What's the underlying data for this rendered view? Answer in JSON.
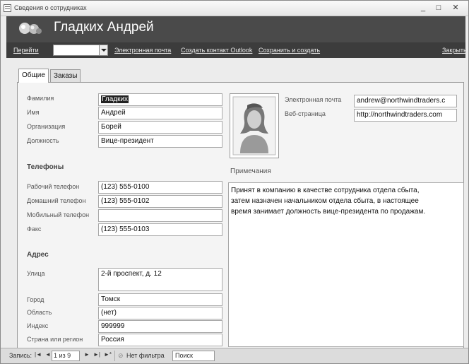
{
  "window": {
    "title": "Сведения о сотрудниках",
    "minimize": "_",
    "maximize": "□",
    "close": "✕"
  },
  "header": {
    "name": "Гладких Андрей"
  },
  "navbar": {
    "goto_label": "Перейти",
    "goto_value": "",
    "email_link": "Электронная почта",
    "outlook_link": "Создать контакт Outlook",
    "save_new_link": "Сохранить и создать",
    "close_link": "Закрыть"
  },
  "tabs": [
    {
      "label": "Общие"
    },
    {
      "label": "Заказы"
    }
  ],
  "general": {
    "last_name_label": "Фамилия",
    "last_name": "Гладких",
    "first_name_label": "Имя",
    "first_name": "Андрей",
    "company_label": "Организация",
    "company": "Борей",
    "job_title_label": "Должность",
    "job_title": "Вице-президент"
  },
  "phones": {
    "section": "Телефоны",
    "work_label": "Рабочий телефон",
    "work": "(123) 555-0100",
    "home_label": "Домашний телефон",
    "home": "(123) 555-0102",
    "mobile_label": "Мобильный телефон",
    "mobile": "",
    "fax_label": "Факс",
    "fax": "(123) 555-0103"
  },
  "address": {
    "section": "Адрес",
    "street_label": "Улица",
    "street": "2-й проспект, д. 12",
    "city_label": "Город",
    "city": "Томск",
    "region_label": "Область",
    "region": "(нет)",
    "zip_label": "Индекс",
    "zip": "999999",
    "country_label": "Страна или регион",
    "country": "Россия"
  },
  "contact": {
    "email_label": "Электронная почта",
    "email": "andrew@northwindtraders.c",
    "web_label": "Веб-страница",
    "web": "http://northwindtraders.com"
  },
  "notes": {
    "label": "Примечания",
    "text": "Принят в компанию в качестве сотрудника отдела сбыта,\nзатем назначен начальником отдела сбыта, в настоящее\nвремя занимает должность вице-президента по продажам."
  },
  "status": {
    "records_label": "Запись:",
    "first": "|◄",
    "prev": "◄",
    "record_value": "1 из 9",
    "next": "►",
    "last": "►|",
    "new": "►*",
    "filter": "Нет фильтра",
    "search": "Поиск"
  }
}
